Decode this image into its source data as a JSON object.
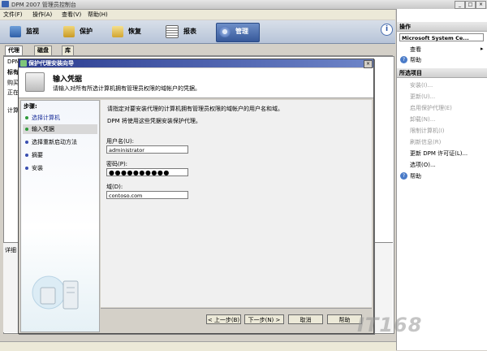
{
  "window": {
    "title": "DPM 2007 管理员控制台",
    "controls": [
      "_",
      "□",
      "×"
    ]
  },
  "menu": [
    "文件(F)",
    "操作(A)",
    "查看(V)",
    "帮助(H)"
  ],
  "toolbar": {
    "tabs": [
      {
        "label": "监视",
        "icon": "monitor-icon"
      },
      {
        "label": "保护",
        "icon": "shield-icon"
      },
      {
        "label": "恢复",
        "icon": "recovery-icon"
      },
      {
        "label": "报表",
        "icon": "report-icon"
      },
      {
        "label": "管理",
        "icon": "gear-icon",
        "selected": true
      }
    ],
    "info": "i"
  },
  "subtabs": [
    "代理",
    "磁盘",
    "库"
  ],
  "background": {
    "labels": [
      "DPM",
      "标有",
      "购买",
      "正在",
      "计算",
      "详细"
    ]
  },
  "actions": {
    "section1": "操作",
    "computer": "Microsoft System Ce...",
    "items1": [
      {
        "label": "查看",
        "arrow": "▸"
      },
      {
        "label": "帮助"
      }
    ],
    "section2": "所选项目",
    "items2": [
      {
        "label": "安装(I)...",
        "dim": true
      },
      {
        "label": "更新(U)...",
        "dim": true
      },
      {
        "label": "启用保护代理(E)",
        "dim": true
      },
      {
        "label": "卸载(N)...",
        "dim": true
      },
      {
        "label": "限制计算机(I)",
        "dim": true
      },
      {
        "label": "刷新信息(R)",
        "dim": true
      },
      {
        "label": "更新 DPM 许可证(L)...",
        "dim": false
      },
      {
        "label": "选项(O)...",
        "dim": false
      },
      {
        "label": "帮助",
        "dim": false
      }
    ]
  },
  "dialog": {
    "title": "保护代理安装向导",
    "close": "×",
    "header_title": "输入凭据",
    "header_sub": "请输入对所有所选计算机拥有管理员权限的域帐户的凭据。",
    "steps_title": "步骤:",
    "steps": [
      {
        "label": "选择计算机",
        "color": "#2e9a3a"
      },
      {
        "label": "输入凭据",
        "color": "#2e9a3a"
      },
      {
        "label": "选择重新启动方法",
        "color": "#3a4fb0"
      },
      {
        "label": "摘要",
        "color": "#3a4fb0"
      },
      {
        "label": "安装",
        "color": "#3a4fb0"
      }
    ],
    "instruction": "请指定对要安装代理的计算机拥有管理员权限的域帐户的用户名和域。",
    "note": "DPM 将使用这些凭据安装保护代理。",
    "username_label": "用户名(U):",
    "username_value": "administrator",
    "password_label": "密码(P):",
    "password_value": "●●●●●●●●●●",
    "domain_label": "域(D):",
    "domain_value": "contoso.com",
    "buttons": {
      "back": "< 上一步(B)",
      "next": "下一步(N) >",
      "cancel": "取消",
      "help": "帮助"
    }
  },
  "watermark": "IT168",
  "colors": {
    "accent": "#37599a",
    "dialog_title": "#2a3b8f",
    "step_done": "#2e9a3a",
    "step_todo": "#3a4fb0"
  }
}
